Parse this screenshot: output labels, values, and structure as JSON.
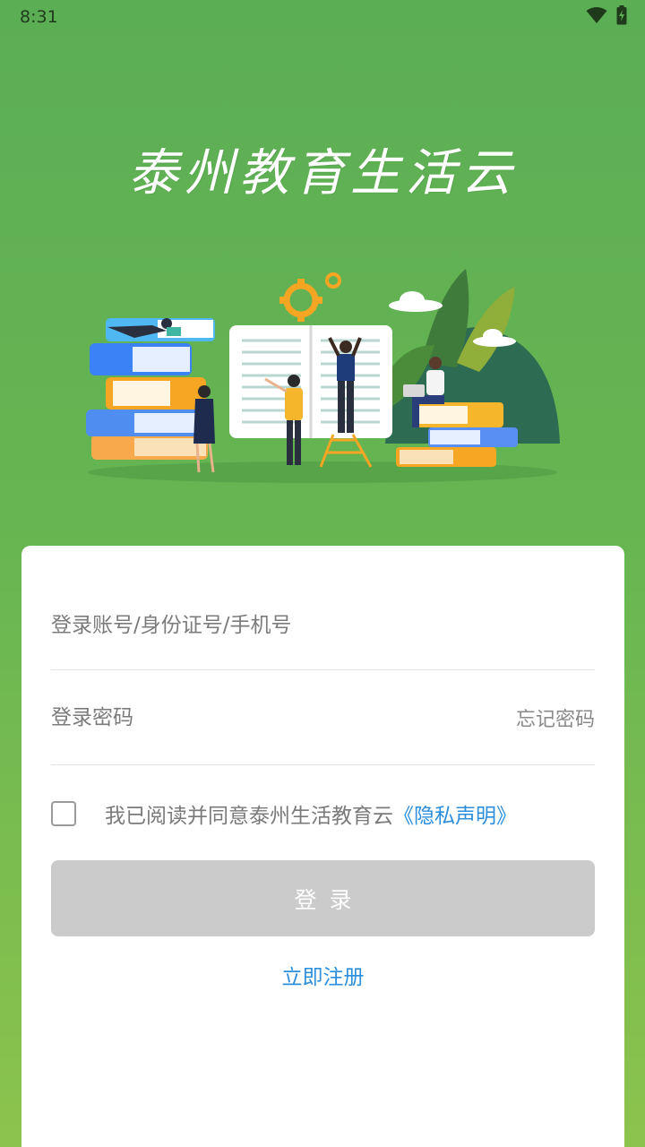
{
  "status_bar": {
    "time": "8:31",
    "icons": [
      "wifi-icon",
      "battery-charging-icon"
    ]
  },
  "app_title": "泰州教育生活云",
  "form": {
    "account_placeholder": "登录账号/身份证号/手机号",
    "password_placeholder": "登录密码",
    "forgot_password": "忘记密码",
    "agreement_text": "我已阅读并同意泰州生活教育云",
    "privacy_link": "《隐私声明》",
    "agreement_checked": false,
    "login_button": "登录",
    "register_link": "立即注册"
  },
  "colors": {
    "background_top": "#5cae55",
    "background_bottom": "#8cc34d",
    "link": "#2d8fdc",
    "button_disabled": "#cbcbcb"
  }
}
